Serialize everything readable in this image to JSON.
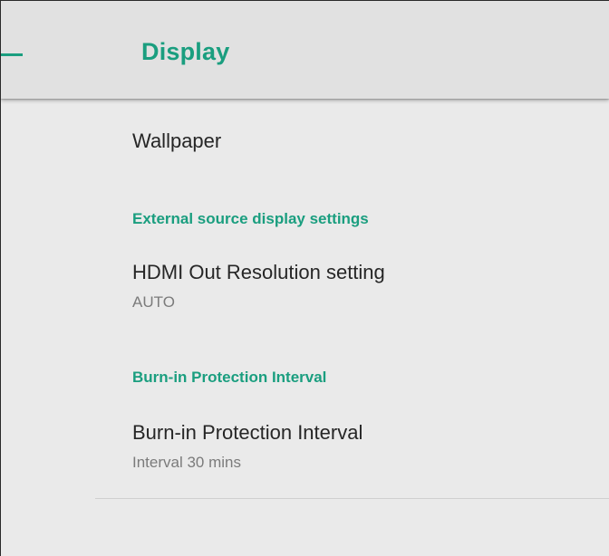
{
  "header": {
    "title": "Display",
    "nav_icon": "back-arrow-icon",
    "accent_color": "#1a9e7f"
  },
  "settings": {
    "wallpaper": {
      "title": "Wallpaper"
    },
    "external_source": {
      "category": "External source display settings",
      "hdmi": {
        "title": "HDMI Out Resolution setting",
        "summary": "AUTO"
      }
    },
    "burn_in": {
      "category": "Burn-in Protection Interval",
      "interval": {
        "title": "Burn-in Protection Interval",
        "summary": "Interval 30 mins"
      }
    }
  }
}
